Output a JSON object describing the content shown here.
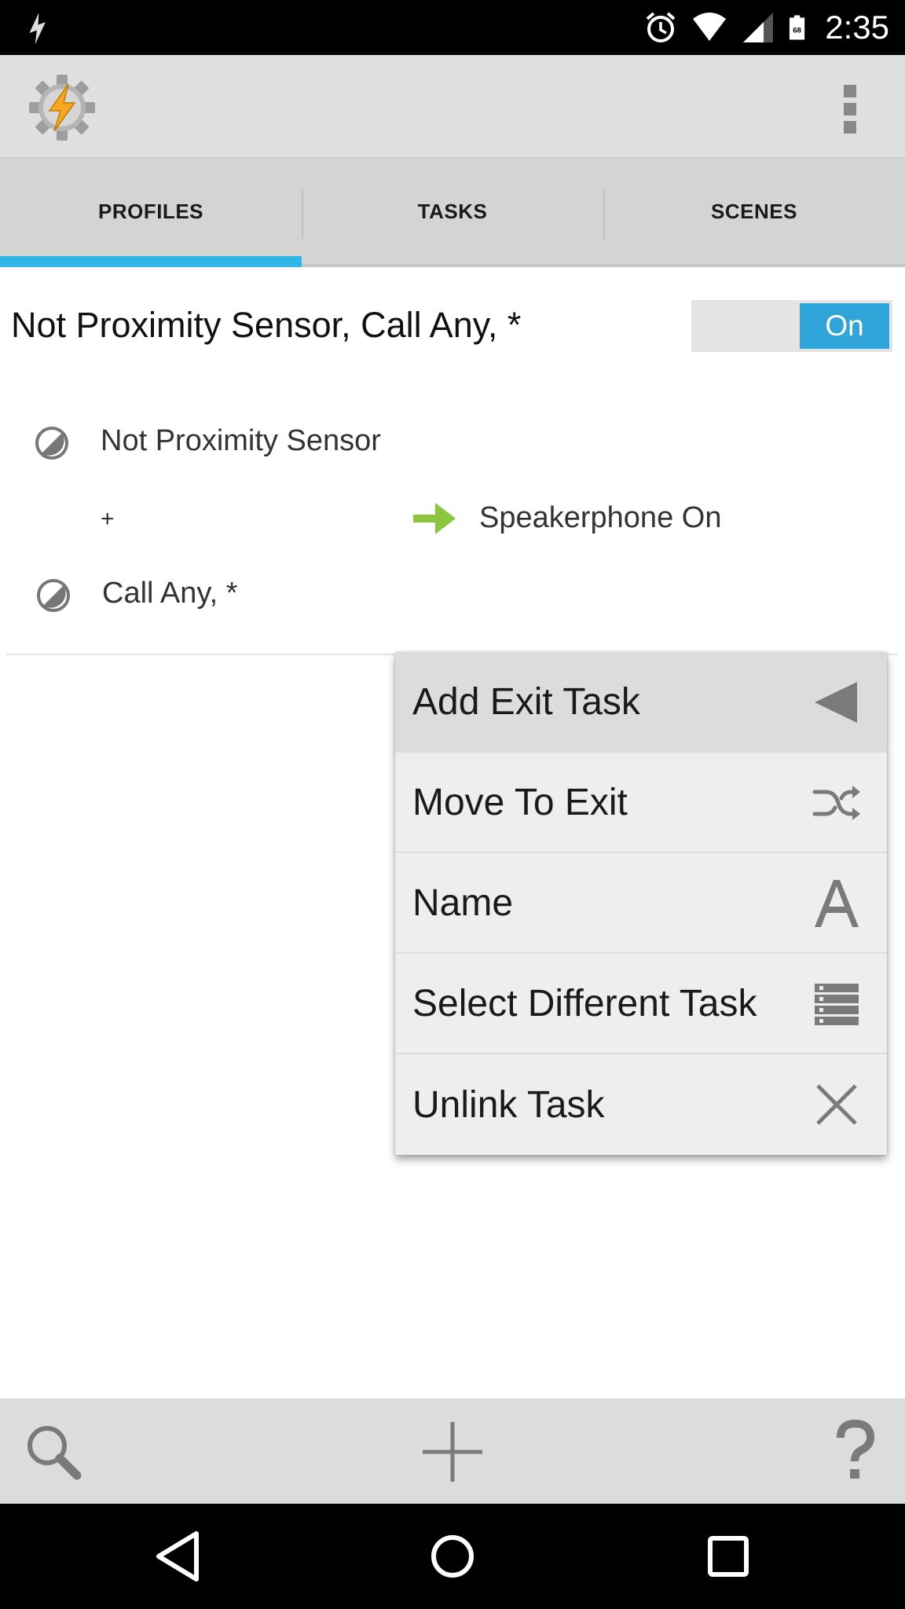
{
  "status_bar": {
    "time": "2:35",
    "battery_level": "68",
    "icons": [
      "flash-notification-icon",
      "alarm-icon",
      "wifi-icon",
      "cell-signal-icon",
      "battery-icon"
    ]
  },
  "action_bar": {
    "logo": "tasker-logo",
    "overflow_icon": "overflow-menu-icon"
  },
  "tabs": [
    {
      "label": "PROFILES",
      "active": true
    },
    {
      "label": "TASKS",
      "active": false
    },
    {
      "label": "SCENES",
      "active": false
    }
  ],
  "colors": {
    "accent": "#33b5e5",
    "toggle_on": "#2fa5d9",
    "task_arrow": "#8cc63f"
  },
  "profile": {
    "title": "Not Proximity Sensor, Call Any, *",
    "toggle_label": "On",
    "contexts": [
      {
        "label": "Not Proximity Sensor",
        "icon": "context-state-icon"
      },
      {
        "label": "Call Any, *",
        "icon": "context-state-icon"
      }
    ],
    "plus": "+",
    "task": {
      "label": "Speakerphone On",
      "icon": "enter-task-arrow-icon"
    }
  },
  "menu": {
    "items": [
      {
        "label": "Add Exit Task",
        "icon": "exit-triangle-icon",
        "highlighted": true
      },
      {
        "label": "Move To Exit",
        "icon": "shuffle-icon",
        "highlighted": false
      },
      {
        "label": "Name",
        "icon": "letter-a-icon",
        "highlighted": false
      },
      {
        "label": "Select Different Task",
        "icon": "list-icon",
        "highlighted": false
      },
      {
        "label": "Unlink Task",
        "icon": "close-icon",
        "highlighted": false
      }
    ]
  },
  "bottom_bar": [
    "search-icon",
    "add-icon",
    "help-icon"
  ],
  "nav_bar": [
    "back-icon",
    "home-icon",
    "recents-icon"
  ]
}
